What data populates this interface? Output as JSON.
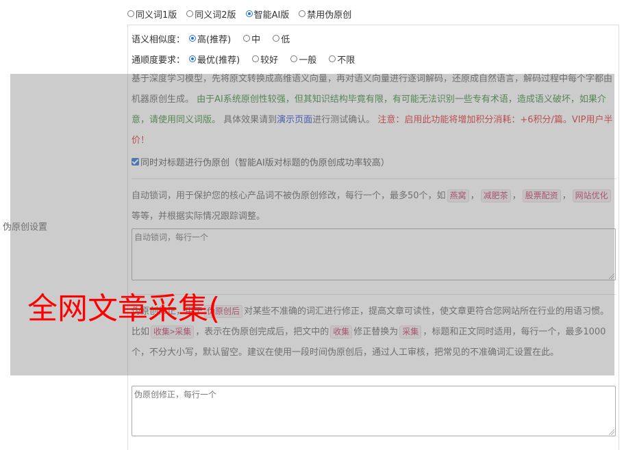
{
  "section_label": "伪原创设置",
  "mode": {
    "options": [
      {
        "label": "同义词1版",
        "selected": false
      },
      {
        "label": "同义词2版",
        "selected": false
      },
      {
        "label": "智能AI版",
        "selected": true
      },
      {
        "label": "禁用伪原创",
        "selected": false
      }
    ]
  },
  "similarity": {
    "label": "语义相似度：",
    "options": [
      {
        "label": "高(推荐)",
        "selected": true
      },
      {
        "label": "中",
        "selected": false
      },
      {
        "label": "低",
        "selected": false
      }
    ]
  },
  "fluency": {
    "label": "通顺度要求：",
    "options": [
      {
        "label": "最优(推荐)",
        "selected": true
      },
      {
        "label": "较好",
        "selected": false
      },
      {
        "label": "一般",
        "selected": false
      },
      {
        "label": "不限",
        "selected": false
      }
    ]
  },
  "ai_desc": {
    "intro": "基于深度学习模型，先将原文转换成高维语义向量，再对语义向量进行逐词解码，还原成自然语言，解码过程中每个字都由机器原创生成。",
    "warning_green": "由于AI系统原创性较强，但其知识结构毕竟有限，有可能无法识别一些专有术语，造成语义破坏，如果介意，请使用同义词版。",
    "test_prefix": "具体效果请到",
    "test_link": "演示页面",
    "test_suffix": "进行测试确认。",
    "notice_red": "注意：启用此功能将增加积分消耗：+6积分/篇。VIP用户半价！"
  },
  "title_checkbox": {
    "checked": true,
    "label": "同时对标题进行伪原创（智能AI版对标题的伪原创成功率较高）"
  },
  "lock_words": {
    "desc_prefix": "自动锁词，用于保护您的核心产品词不被伪原创修改，每行一个，最多50个，如",
    "examples": [
      "燕窝",
      "减肥茶",
      "股票配资",
      "网站优化"
    ],
    "sep": "，",
    "desc_suffix": "等等，并根据实际情况跟踪调整。",
    "placeholder": "自动锁词，每行一个"
  },
  "correction": {
    "lead": "伪原创修正，用于",
    "chip_after": "伪原创后",
    "text1": "对某些不准确的词汇进行修正，提高文章可读性，使文章更符合您网站所在行业的用语习惯。比如",
    "chip_example": "收集>采集",
    "text2": "，表示在伪原创完成后，把文中的",
    "chip_from": "收集",
    "text3": "修正替换为",
    "chip_to": "采集",
    "text4": "，标题和正文同时适用，每行一个，最多1000个，不分大小写，默认留空。建议在使用一段时间伪原创后，通过人工审核，把常见的不准确词汇设置在此。",
    "placeholder": "伪原创修正，每行一个"
  },
  "watermark": "全网文章采集(",
  "colors": {
    "accent": "#2a6fd6",
    "green_text": "#3a8a3a",
    "red_text": "#e03030",
    "link": "#2244cc",
    "watermark": "#ff0000",
    "overlay": "rgba(128,128,128,0.4)"
  }
}
